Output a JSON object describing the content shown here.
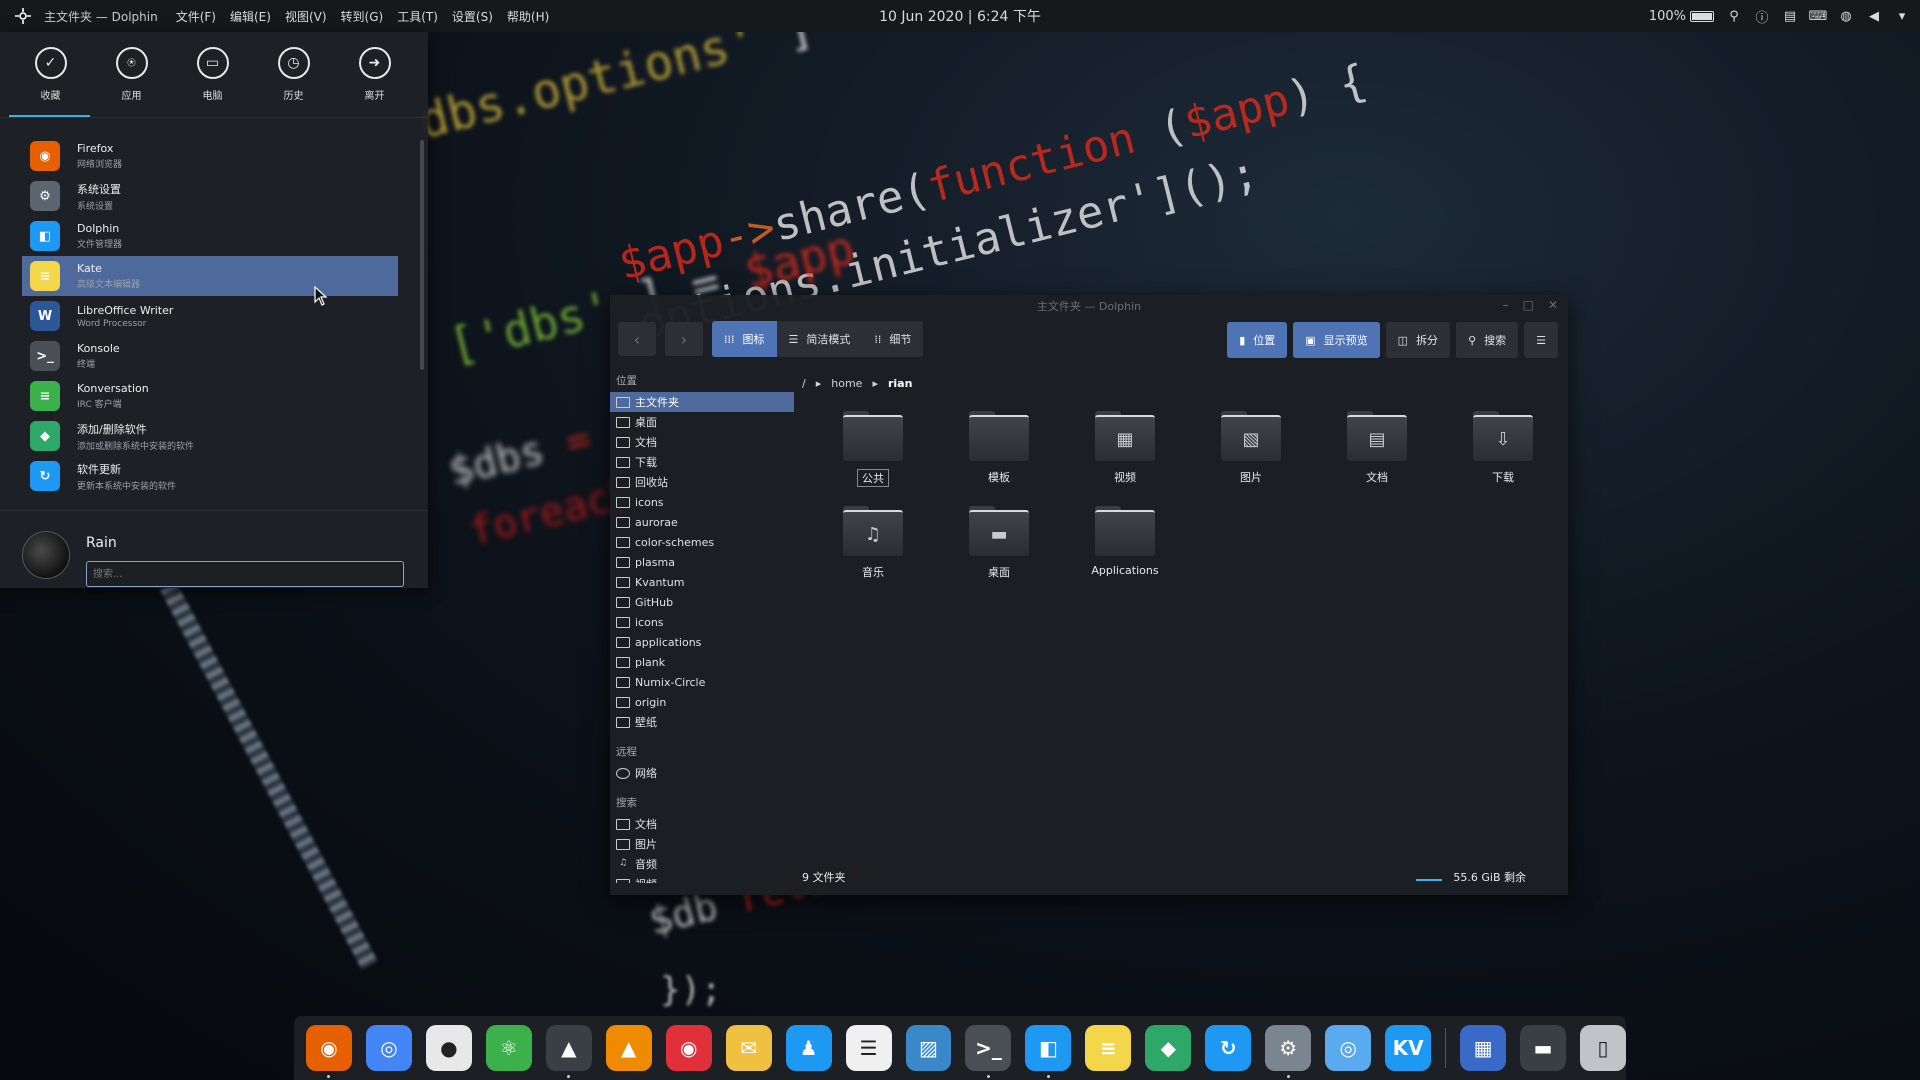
{
  "topbar": {
    "app_title": "主文件夹 — Dolphin",
    "menus": [
      "文件(F)",
      "编辑(E)",
      "视图(V)",
      "转到(G)",
      "工具(T)",
      "设置(S)",
      "帮助(H)"
    ],
    "clock": "10 Jun 2020 | 6:24 下午",
    "battery": "100%"
  },
  "launcher": {
    "categories": [
      "收藏",
      "应用",
      "电脑",
      "历史",
      "离开"
    ],
    "apps": [
      {
        "name": "Firefox",
        "desc": "网络浏览器",
        "color": "#e66000",
        "glyph": "◉"
      },
      {
        "name": "系统设置",
        "desc": "系统设置",
        "color": "#5b6570",
        "glyph": "⚙"
      },
      {
        "name": "Dolphin",
        "desc": "文件管理器",
        "color": "#1d99f3",
        "glyph": "◧"
      },
      {
        "name": "Kate",
        "desc": "高级文本编辑器",
        "color": "#f3d64a",
        "glyph": "≡"
      },
      {
        "name": "LibreOffice Writer",
        "desc": "Word Processor",
        "color": "#2b5797",
        "glyph": "W"
      },
      {
        "name": "Konsole",
        "desc": "终端",
        "color": "#4a4f55",
        "glyph": ">_"
      },
      {
        "name": "Konversation",
        "desc": "IRC 客户端",
        "color": "#3cb04a",
        "glyph": "≡"
      },
      {
        "name": "添加/删除软件",
        "desc": "添加或删除系统中安装的软件",
        "color": "#2ea868",
        "glyph": "◆"
      },
      {
        "name": "软件更新",
        "desc": "更新本系统中安装的软件",
        "color": "#1d99f3",
        "glyph": "↻"
      }
    ],
    "user": "Rain",
    "search_placeholder": "搜索..."
  },
  "dolphin": {
    "title": "主文件夹 — Dolphin",
    "views": [
      "图标",
      "简洁模式",
      "细节"
    ],
    "tools": [
      "位置",
      "显示预览",
      "拆分",
      "搜索"
    ],
    "places_title": "位置",
    "places": [
      "主文件夹",
      "桌面",
      "文档",
      "下载",
      "回收站",
      "icons",
      "aurorae",
      "color-schemes",
      "plasma",
      "Kvantum",
      "GitHub",
      "icons",
      "applications",
      "plank",
      "Numix-Circle",
      "origin",
      "壁纸"
    ],
    "remote_title": "远程",
    "remote": [
      "网络"
    ],
    "search_title": "搜索",
    "search": [
      "文档",
      "图片",
      "音频",
      "视频"
    ],
    "breadcrumb": [
      "/",
      "home",
      "rian"
    ],
    "files": [
      {
        "name": "公共",
        "emblem": ""
      },
      {
        "name": "模板",
        "emblem": ""
      },
      {
        "name": "视频",
        "emblem": "▦"
      },
      {
        "name": "图片",
        "emblem": "▧"
      },
      {
        "name": "文档",
        "emblem": "▤"
      },
      {
        "name": "下载",
        "emblem": "⇩"
      },
      {
        "name": "音乐",
        "emblem": "♫"
      },
      {
        "name": "桌面",
        "emblem": "▬"
      },
      {
        "name": "Applications",
        "emblem": ""
      }
    ],
    "status_count": "9 文件夹",
    "status_free": "55.6 GiB 剩余"
  },
  "dock": [
    {
      "name": "firefox",
      "color": "#e66000",
      "glyph": "◉",
      "running": true
    },
    {
      "name": "chrome",
      "color": "#4285f4",
      "glyph": "◎",
      "running": false
    },
    {
      "name": "github",
      "color": "#e8e8e8",
      "glyph": "●",
      "running": false
    },
    {
      "name": "atom",
      "color": "#3cb04a",
      "glyph": "⚛",
      "running": false
    },
    {
      "name": "inkscape",
      "color": "#3a3f44",
      "glyph": "▲",
      "running": true
    },
    {
      "name": "vlc",
      "color": "#f08a00",
      "glyph": "▲",
      "running": false
    },
    {
      "name": "netease-music",
      "color": "#e0303a",
      "glyph": "◉",
      "running": false
    },
    {
      "name": "mail",
      "color": "#f0c040",
      "glyph": "✉",
      "running": false
    },
    {
      "name": "qq",
      "color": "#1d99f3",
      "glyph": "♟",
      "running": false
    },
    {
      "name": "tasks",
      "color": "#f0f0f0",
      "glyph": "☰",
      "running": false
    },
    {
      "name": "photos",
      "color": "#3a88c8",
      "glyph": "▨",
      "running": false
    },
    {
      "name": "konsole",
      "color": "#4a4f55",
      "glyph": ">_",
      "running": true
    },
    {
      "name": "dolphin",
      "color": "#1d99f3",
      "glyph": "◧",
      "running": true
    },
    {
      "name": "kate",
      "color": "#f3d64a",
      "glyph": "≡",
      "running": false
    },
    {
      "name": "discover",
      "color": "#2ea868",
      "glyph": "◆",
      "running": false
    },
    {
      "name": "update",
      "color": "#1d99f3",
      "glyph": "↻",
      "running": false
    },
    {
      "name": "settings",
      "color": "#7a858f",
      "glyph": "⚙",
      "running": true
    },
    {
      "name": "browser",
      "color": "#5aaaf0",
      "glyph": "◎",
      "running": false
    },
    {
      "name": "kvantum",
      "color": "#1d99f3",
      "glyph": "KV",
      "running": false
    },
    {
      "name": "launchpad",
      "color": "#3a6ac8",
      "glyph": "▦",
      "running": false
    },
    {
      "name": "desktop",
      "color": "#3a3f44",
      "glyph": "▬",
      "running": false
    },
    {
      "name": "trash",
      "color": "#c0c4c8",
      "glyph": "▯",
      "running": false
    }
  ]
}
